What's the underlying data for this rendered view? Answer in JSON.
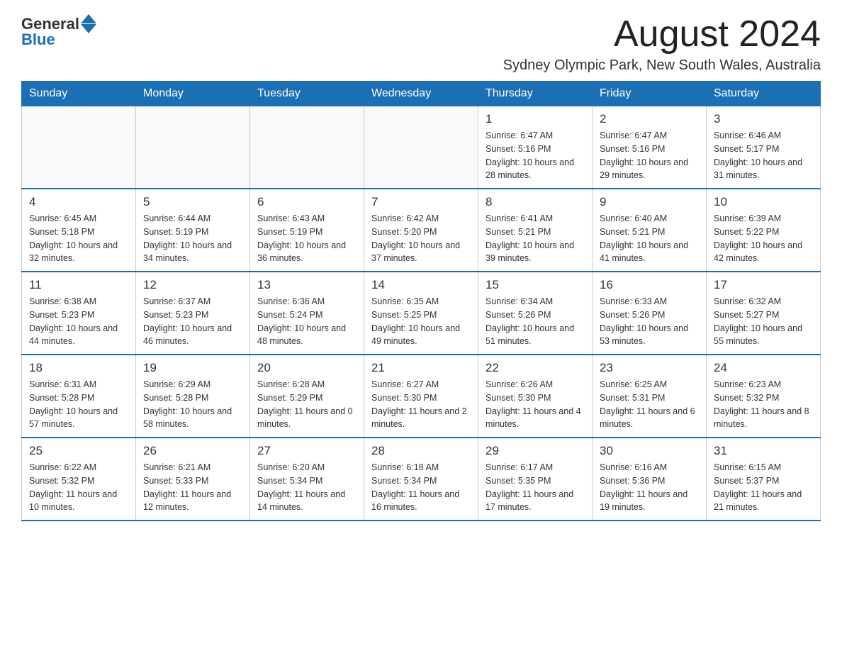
{
  "logo": {
    "general": "General",
    "blue": "Blue"
  },
  "header": {
    "month_title": "August 2024",
    "location": "Sydney Olympic Park, New South Wales, Australia"
  },
  "weekdays": [
    "Sunday",
    "Monday",
    "Tuesday",
    "Wednesday",
    "Thursday",
    "Friday",
    "Saturday"
  ],
  "weeks": [
    [
      {
        "day": "",
        "info": ""
      },
      {
        "day": "",
        "info": ""
      },
      {
        "day": "",
        "info": ""
      },
      {
        "day": "",
        "info": ""
      },
      {
        "day": "1",
        "info": "Sunrise: 6:47 AM\nSunset: 5:16 PM\nDaylight: 10 hours and 28 minutes."
      },
      {
        "day": "2",
        "info": "Sunrise: 6:47 AM\nSunset: 5:16 PM\nDaylight: 10 hours and 29 minutes."
      },
      {
        "day": "3",
        "info": "Sunrise: 6:46 AM\nSunset: 5:17 PM\nDaylight: 10 hours and 31 minutes."
      }
    ],
    [
      {
        "day": "4",
        "info": "Sunrise: 6:45 AM\nSunset: 5:18 PM\nDaylight: 10 hours and 32 minutes."
      },
      {
        "day": "5",
        "info": "Sunrise: 6:44 AM\nSunset: 5:19 PM\nDaylight: 10 hours and 34 minutes."
      },
      {
        "day": "6",
        "info": "Sunrise: 6:43 AM\nSunset: 5:19 PM\nDaylight: 10 hours and 36 minutes."
      },
      {
        "day": "7",
        "info": "Sunrise: 6:42 AM\nSunset: 5:20 PM\nDaylight: 10 hours and 37 minutes."
      },
      {
        "day": "8",
        "info": "Sunrise: 6:41 AM\nSunset: 5:21 PM\nDaylight: 10 hours and 39 minutes."
      },
      {
        "day": "9",
        "info": "Sunrise: 6:40 AM\nSunset: 5:21 PM\nDaylight: 10 hours and 41 minutes."
      },
      {
        "day": "10",
        "info": "Sunrise: 6:39 AM\nSunset: 5:22 PM\nDaylight: 10 hours and 42 minutes."
      }
    ],
    [
      {
        "day": "11",
        "info": "Sunrise: 6:38 AM\nSunset: 5:23 PM\nDaylight: 10 hours and 44 minutes."
      },
      {
        "day": "12",
        "info": "Sunrise: 6:37 AM\nSunset: 5:23 PM\nDaylight: 10 hours and 46 minutes."
      },
      {
        "day": "13",
        "info": "Sunrise: 6:36 AM\nSunset: 5:24 PM\nDaylight: 10 hours and 48 minutes."
      },
      {
        "day": "14",
        "info": "Sunrise: 6:35 AM\nSunset: 5:25 PM\nDaylight: 10 hours and 49 minutes."
      },
      {
        "day": "15",
        "info": "Sunrise: 6:34 AM\nSunset: 5:26 PM\nDaylight: 10 hours and 51 minutes."
      },
      {
        "day": "16",
        "info": "Sunrise: 6:33 AM\nSunset: 5:26 PM\nDaylight: 10 hours and 53 minutes."
      },
      {
        "day": "17",
        "info": "Sunrise: 6:32 AM\nSunset: 5:27 PM\nDaylight: 10 hours and 55 minutes."
      }
    ],
    [
      {
        "day": "18",
        "info": "Sunrise: 6:31 AM\nSunset: 5:28 PM\nDaylight: 10 hours and 57 minutes."
      },
      {
        "day": "19",
        "info": "Sunrise: 6:29 AM\nSunset: 5:28 PM\nDaylight: 10 hours and 58 minutes."
      },
      {
        "day": "20",
        "info": "Sunrise: 6:28 AM\nSunset: 5:29 PM\nDaylight: 11 hours and 0 minutes."
      },
      {
        "day": "21",
        "info": "Sunrise: 6:27 AM\nSunset: 5:30 PM\nDaylight: 11 hours and 2 minutes."
      },
      {
        "day": "22",
        "info": "Sunrise: 6:26 AM\nSunset: 5:30 PM\nDaylight: 11 hours and 4 minutes."
      },
      {
        "day": "23",
        "info": "Sunrise: 6:25 AM\nSunset: 5:31 PM\nDaylight: 11 hours and 6 minutes."
      },
      {
        "day": "24",
        "info": "Sunrise: 6:23 AM\nSunset: 5:32 PM\nDaylight: 11 hours and 8 minutes."
      }
    ],
    [
      {
        "day": "25",
        "info": "Sunrise: 6:22 AM\nSunset: 5:32 PM\nDaylight: 11 hours and 10 minutes."
      },
      {
        "day": "26",
        "info": "Sunrise: 6:21 AM\nSunset: 5:33 PM\nDaylight: 11 hours and 12 minutes."
      },
      {
        "day": "27",
        "info": "Sunrise: 6:20 AM\nSunset: 5:34 PM\nDaylight: 11 hours and 14 minutes."
      },
      {
        "day": "28",
        "info": "Sunrise: 6:18 AM\nSunset: 5:34 PM\nDaylight: 11 hours and 16 minutes."
      },
      {
        "day": "29",
        "info": "Sunrise: 6:17 AM\nSunset: 5:35 PM\nDaylight: 11 hours and 17 minutes."
      },
      {
        "day": "30",
        "info": "Sunrise: 6:16 AM\nSunset: 5:36 PM\nDaylight: 11 hours and 19 minutes."
      },
      {
        "day": "31",
        "info": "Sunrise: 6:15 AM\nSunset: 5:37 PM\nDaylight: 11 hours and 21 minutes."
      }
    ]
  ]
}
